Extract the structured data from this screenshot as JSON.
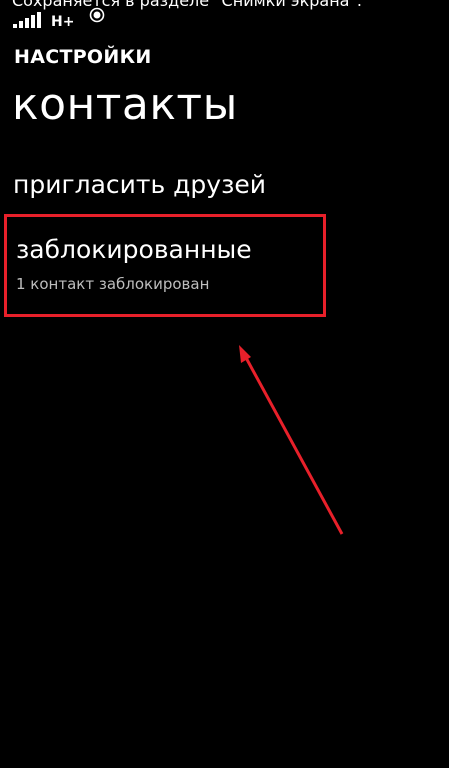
{
  "status_bar": {
    "toast": "Сохраняется в разделе \"Снимки экрана\".",
    "network": "H+",
    "icons": [
      "signal-icon",
      "location-icon"
    ]
  },
  "header": {
    "app_title": "НАСТРОЙКИ",
    "page_title": "контакты"
  },
  "menu": {
    "invite_label": "пригласить друзей",
    "blocked": {
      "label": "заблокированные",
      "subtitle": "1 контакт заблокирован"
    }
  },
  "colors": {
    "background": "#000000",
    "text": "#ffffff",
    "subtitle": "#bdbdbd",
    "annotation": "#e8202a"
  }
}
